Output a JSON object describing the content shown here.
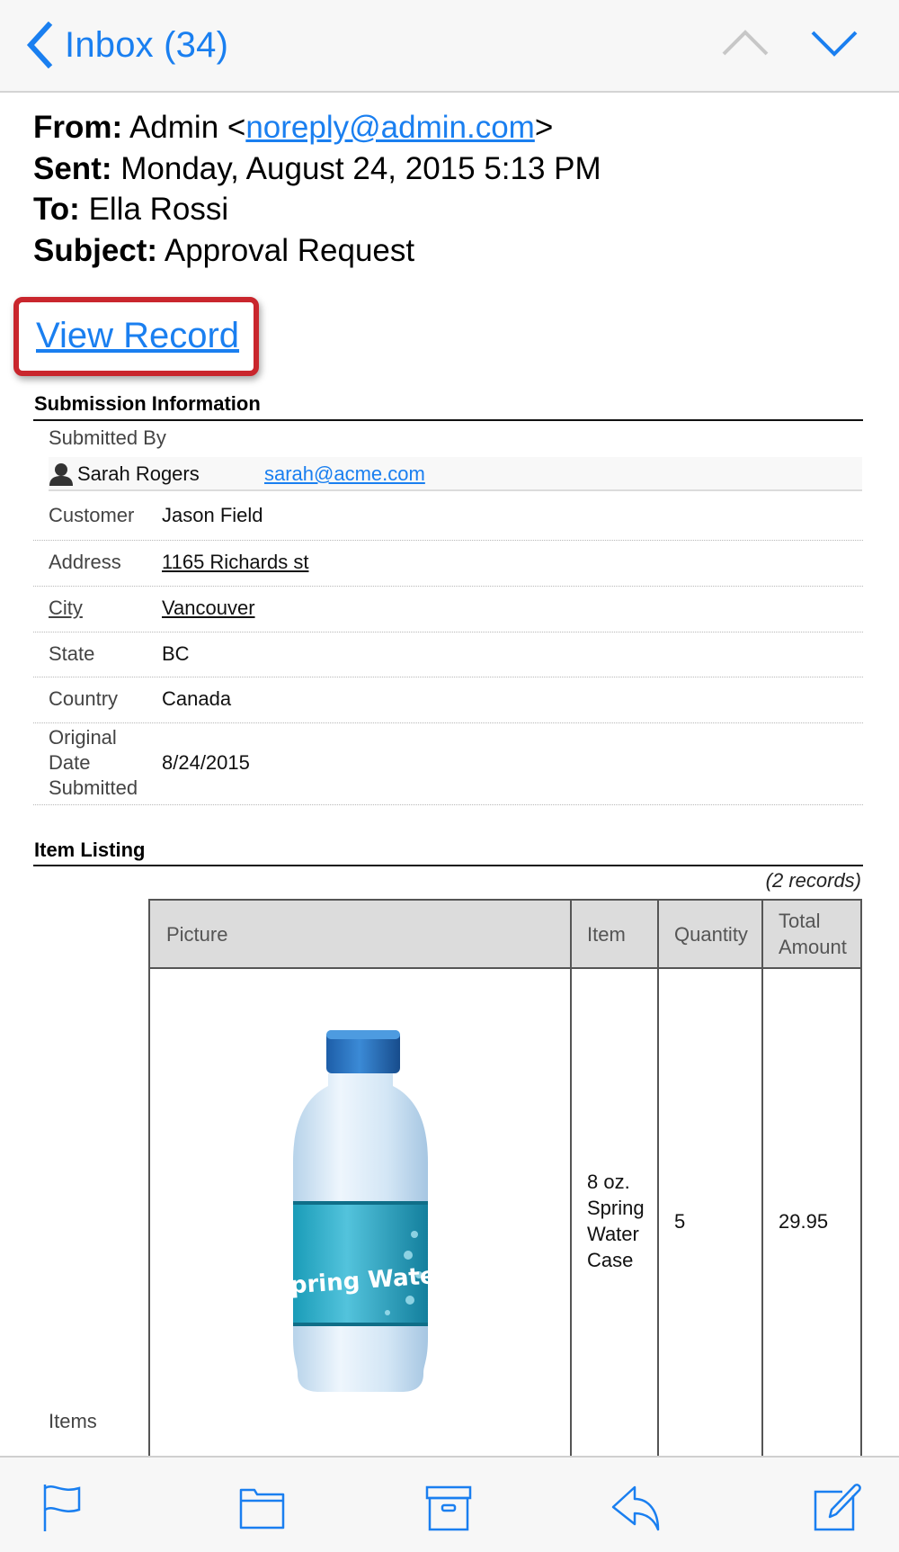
{
  "nav": {
    "back_label": "Inbox (34)",
    "back_icon": "chevron-left-icon",
    "prev_icon": "chevron-up-icon",
    "next_icon": "chevron-down-icon",
    "accent": "#1a7ff0",
    "disabled": "#c7c7c7"
  },
  "email": {
    "from_label": "From:",
    "from_name": "Admin <",
    "from_email": "noreply@admin.com",
    "from_close": ">",
    "sent_label": "Sent:",
    "sent_value": "Monday, August 24, 2015 5:13 PM",
    "to_label": "To:",
    "to_value": "Ella Rossi",
    "subject_label": "Subject:",
    "subject_value": "Approval Request",
    "view_record": "View Record",
    "highlight_color": "#c9262d"
  },
  "submission": {
    "title": "Submission Information",
    "submitted_by_label": "Submitted By",
    "submitter_name": "Sarah Rogers",
    "submitter_email": "sarah@acme.com",
    "fields": [
      {
        "label": "Customer",
        "value": "Jason Field"
      },
      {
        "label": "Address",
        "value": "1165 Richards st"
      },
      {
        "label": "City",
        "value": "Vancouver"
      },
      {
        "label": "State",
        "value": "BC"
      },
      {
        "label": "Country",
        "value": "Canada"
      },
      {
        "label_lines": [
          "Original",
          "Date",
          "Submitted"
        ],
        "value": "8/24/2015"
      }
    ]
  },
  "items": {
    "title": "Item Listing",
    "records": "(2 records)",
    "row_label": "Items",
    "columns": [
      "Picture",
      "Item",
      "Quantity",
      "Total Amount"
    ],
    "total_header_lines": [
      "Total",
      "Amount"
    ],
    "rows": [
      {
        "picture": "Spring Water bottle",
        "picture_text": "Spring Water",
        "item_lines": [
          "8 oz.",
          "Spring",
          "Water",
          "Case"
        ],
        "quantity": "5",
        "total": "29.95"
      }
    ]
  },
  "toolbar": {
    "buttons": [
      "flag-icon",
      "folder-icon",
      "archive-icon",
      "reply-icon",
      "compose-icon"
    ]
  }
}
